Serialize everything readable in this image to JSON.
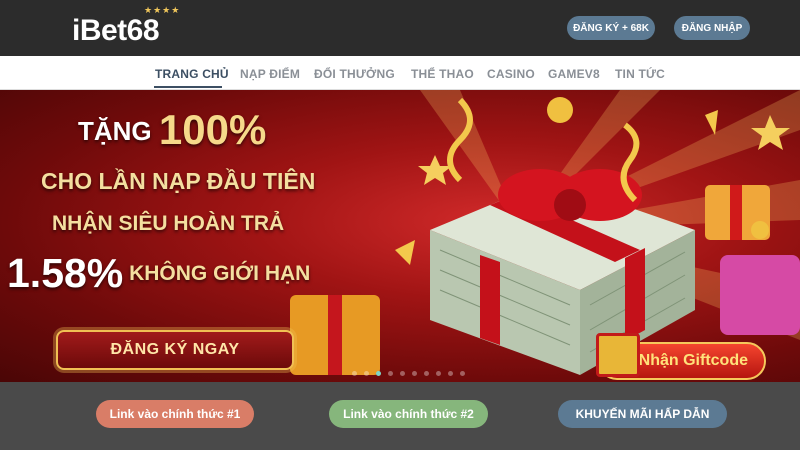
{
  "header": {
    "logo_text": "iBet68",
    "logo_stars": "★★★★",
    "register_label": "ĐĂNG KÝ + 68K",
    "login_label": "ĐĂNG NHẬP"
  },
  "nav": {
    "items": [
      {
        "label": "TRANG CHỦ",
        "active": true
      },
      {
        "label": "NẠP ĐIỂM"
      },
      {
        "label": "ĐỔI THƯỞNG"
      },
      {
        "label": "THỂ THAO"
      },
      {
        "label": "CASINO"
      },
      {
        "label": "GAMEV8"
      },
      {
        "label": "TIN TỨC"
      }
    ]
  },
  "banner": {
    "line1_prefix": "TẶNG ",
    "line1_value": "100%",
    "line2": "CHO LẦN NẠP ĐẦU TIÊN",
    "line3": "NHẬN SIÊU HOÀN TRẢ",
    "line4_value": "1.58%",
    "line4_rest": " KHÔNG GIỚI HẠN",
    "cta_label": "ĐĂNG KÝ NGAY",
    "giftcode_label": "Nhận Giftcode",
    "slide_count": 10,
    "active_slide": 3
  },
  "bottom": {
    "link1_label": "Link vào chính thức #1",
    "link2_label": "Link vào chính thức #2",
    "promo_label": "KHUYẾN MÃI HẤP DẪN"
  },
  "colors": {
    "header_bg": "#2c2c2c",
    "header_button": "#5c7a93",
    "nav_active": "#3c4f63",
    "link1": "#d97d67",
    "link2": "#86b67c",
    "promo": "#5c7a93",
    "banner_red": "#a01414",
    "gold": "#f1c054"
  }
}
